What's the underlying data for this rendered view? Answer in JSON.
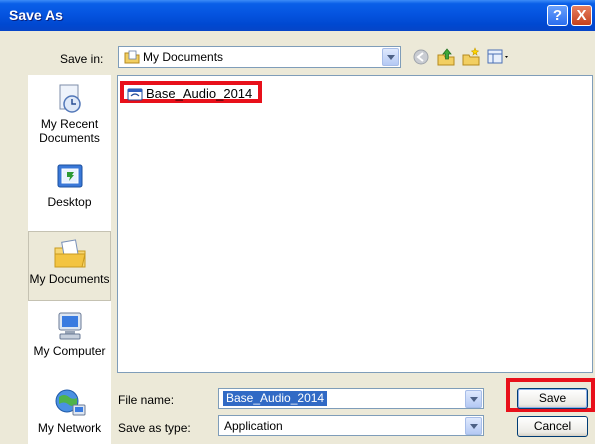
{
  "window": {
    "title": "Save As"
  },
  "title_buttons": {
    "help": "?",
    "close": "X"
  },
  "save_in": {
    "label": "Save in:",
    "value": "My Documents",
    "icon": "folder-documents-icon"
  },
  "toolbar": {
    "icons": [
      "back-icon",
      "up-one-level-icon",
      "create-new-folder-icon",
      "view-menu-icon"
    ]
  },
  "places": [
    {
      "label": "My Recent Documents",
      "icon": "recent-documents-icon"
    },
    {
      "label": "Desktop",
      "icon": "desktop-icon"
    },
    {
      "label": "My Documents",
      "icon": "my-documents-icon",
      "selected": true
    },
    {
      "label": "My Computer",
      "icon": "my-computer-icon"
    },
    {
      "label": "My Network",
      "icon": "my-network-icon"
    }
  ],
  "files": [
    {
      "name": "Base_Audio_2014",
      "icon": "application-file-icon",
      "highlighted": true
    }
  ],
  "file_name": {
    "label": "File name:",
    "value": "Base_Audio_2014"
  },
  "save_as_type": {
    "label": "Save as type:",
    "value": "Application"
  },
  "buttons": {
    "save": "Save",
    "cancel": "Cancel"
  },
  "colors": {
    "title_bar": "#0554e0",
    "dialog_face": "#ece9d8",
    "highlight_outline": "#e8101a",
    "selection": "#316ac5"
  }
}
